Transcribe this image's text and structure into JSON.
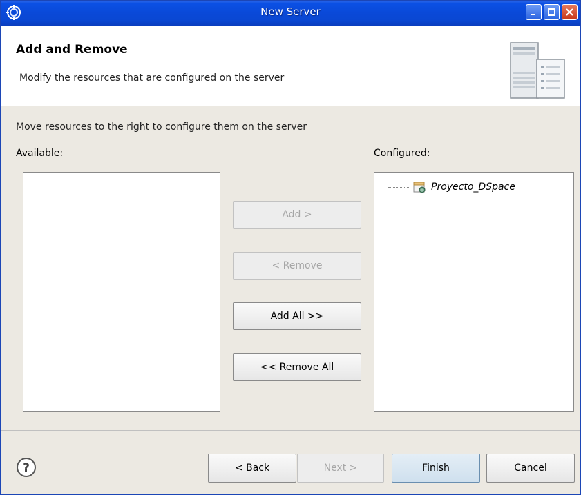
{
  "window": {
    "title": "New Server"
  },
  "banner": {
    "heading": "Add and Remove",
    "description": "Modify the resources that are configured on the server"
  },
  "instruction": "Move resources to the right to configure them on the server",
  "available": {
    "label": "Available:",
    "items": []
  },
  "configured": {
    "label": "Configured:",
    "items": [
      "Proyecto_DSpace"
    ]
  },
  "buttons": {
    "add": "Add >",
    "remove": "< Remove",
    "add_all": "Add All >>",
    "remove_all": "<< Remove All"
  },
  "footer": {
    "back": "< Back",
    "next": "Next >",
    "finish": "Finish",
    "cancel": "Cancel"
  },
  "icons": {
    "app": "eclipse-icon",
    "help": "help-icon",
    "server": "server-icon",
    "project": "web-project-icon"
  }
}
